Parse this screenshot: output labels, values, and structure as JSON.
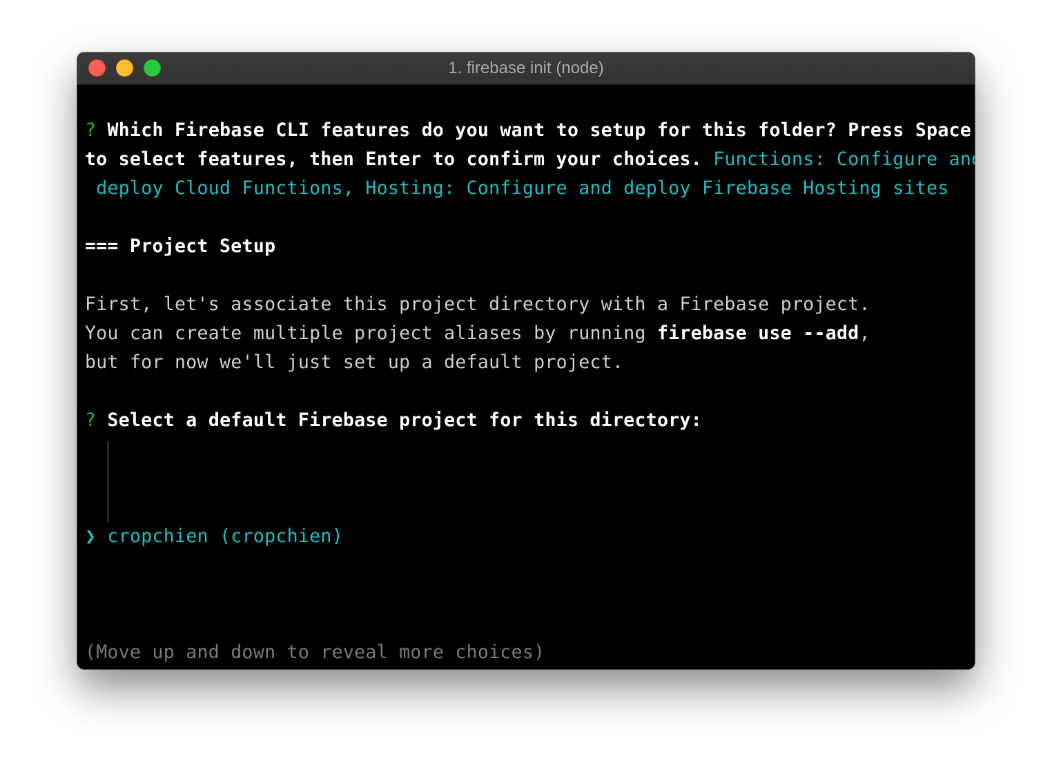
{
  "window": {
    "title": "1. firebase init (node)"
  },
  "terminal": {
    "q1_mark": "?",
    "q1_text_a": "Which Firebase CLI features do you want to setup for this folder? Press Space",
    "q1_text_b": "to select features, then Enter to confirm your choices.",
    "q1_answer_a": " Functions: Configure and",
    "q1_answer_b": " deploy Cloud Functions, Hosting: Configure and deploy Firebase Hosting sites",
    "section_heading": "=== Project Setup",
    "info_line1": "First, let's associate this project directory with a Firebase project.",
    "info_line2_a": "You can create multiple project aliases by running ",
    "info_line2_cmd": "firebase use --add",
    "info_line2_b": ",",
    "info_line3": "but for now we'll just set up a default project.",
    "q2_mark": "?",
    "q2_text": "Select a default Firebase project for this directory:",
    "pointer": "❯",
    "selected_choice": "cropchien (cropchien)",
    "hint": "(Move up and down to reveal more choices)"
  },
  "colors": {
    "prompt_mark": "#2fb02f",
    "answer": "#1fbdc0",
    "background": "#000000",
    "hint": "#7a7a7a"
  }
}
